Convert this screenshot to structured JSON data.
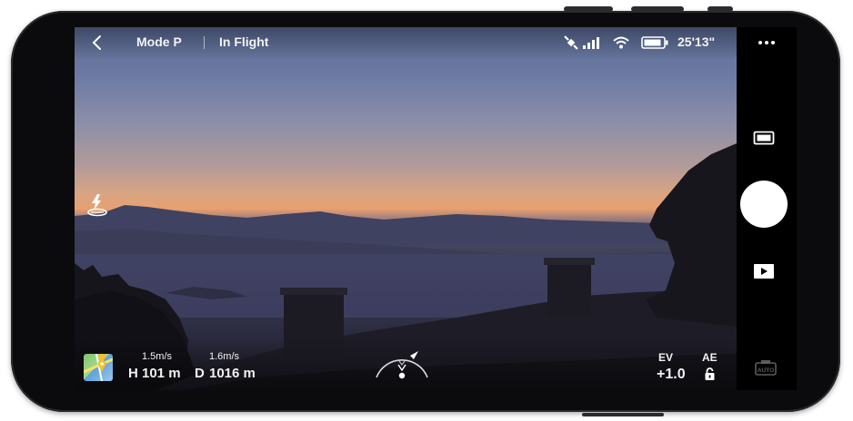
{
  "topbar": {
    "back_icon": "chevron-left-icon",
    "mode": "Mode P",
    "status": "In Flight",
    "gps_icon": "satellite-icon",
    "signal_icon": "signal-bars-icon",
    "wifi_icon": "wifi-icon",
    "battery_icon": "battery-icon",
    "flight_time": "25'13\""
  },
  "sidebar": {
    "more_icon": "more-horizontal-icon",
    "photo_mode_icon": "photo-format-icon",
    "shutter_icon": "shutter-button",
    "playback_icon": "playback-icon",
    "auto_icon": "auto-camera-icon"
  },
  "left_overlay": {
    "takeoff_icon": "takeoff-landing-icon"
  },
  "telemetry": {
    "vertical_speed": "1.5m/s",
    "horizontal_speed": "1.6m/s",
    "height_prefix": "H",
    "height_value": "101 m",
    "distance_prefix": "D",
    "distance_value": "1016 m",
    "map_icon": "map-thumbnail-icon",
    "attitude_icon": "attitude-indicator-icon"
  },
  "exposure": {
    "ev_label": "EV",
    "ev_value": "+1.0",
    "ae_label": "AE",
    "ae_lock_icon": "unlock-icon"
  }
}
